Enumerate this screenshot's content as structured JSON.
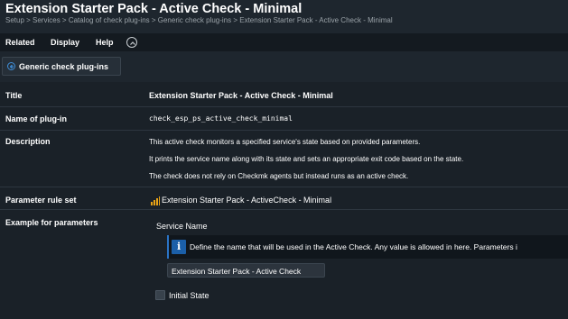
{
  "page": {
    "title": "Extension Starter Pack - Active Check - Minimal",
    "breadcrumb": "Setup > Services > Catalog of check plug-ins > Generic check plug-ins > Extension Starter Pack - Active Check - Minimal"
  },
  "menubar": {
    "related": "Related",
    "display": "Display",
    "help": "Help"
  },
  "back_button": {
    "label": "Generic check plug-ins",
    "icon": "circle-arrow-left-icon"
  },
  "details": {
    "title_label": "Title",
    "title_value": "Extension Starter Pack - Active Check - Minimal",
    "plugin_label": "Name of plug-in",
    "plugin_value": "check_esp_ps_active_check_minimal",
    "description_label": "Description",
    "description_lines": [
      "This active check monitors a specified service's state based on provided parameters.",
      "It prints the service name along with its state and sets an appropriate exit code based on the state.",
      "The check does not rely on Checkmk agents but instead runs as an active check."
    ],
    "ruleset_label": "Parameter rule set",
    "ruleset_value": "Extension Starter Pack - ActiveCheck - Minimal",
    "ruleset_icon": "ruleset-bars-icon",
    "example_label": "Example for parameters"
  },
  "example": {
    "service_name_label": "Service Name",
    "info_text": "Define the name that will be used in the Active Check. Any value is allowed in here. Parameters i",
    "service_name_value": "Extension Starter Pack - Active Check",
    "initial_state_label": "Initial State"
  },
  "colors": {
    "background": "#1e262e",
    "accent_blue": "#1b5fa8",
    "ruleset_orange": "#e8a317"
  }
}
